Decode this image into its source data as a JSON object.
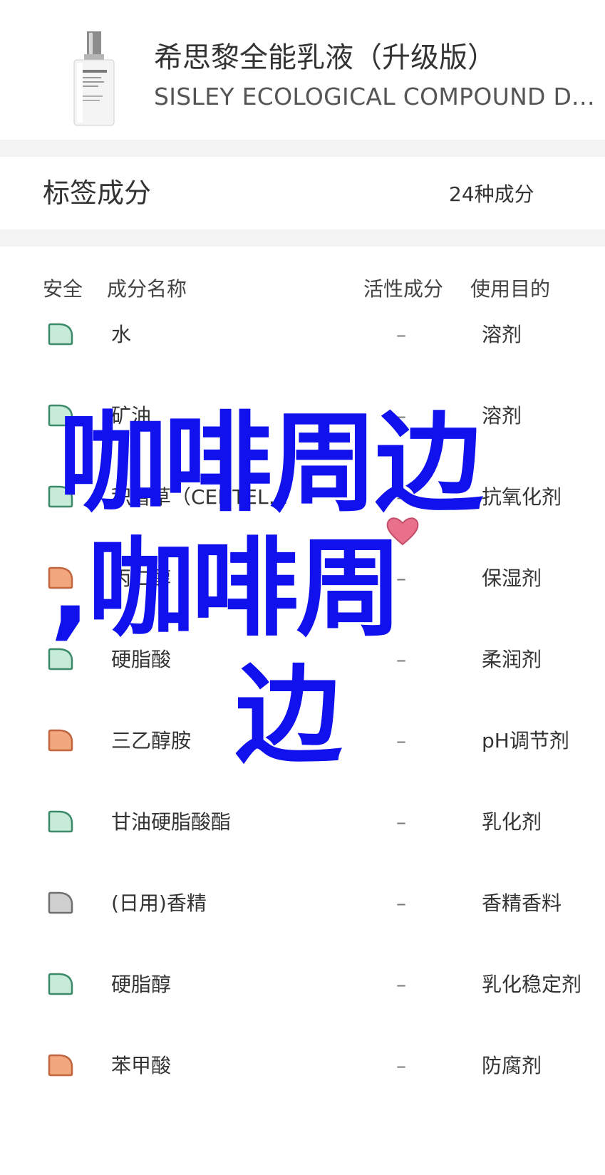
{
  "product": {
    "title": "希思黎全能乳液（升级版）",
    "subtitle": "SISLEY ECOLOGICAL COMPOUND DAY AND NIGHT"
  },
  "tags": {
    "label": "标签成分",
    "count": "24种成分"
  },
  "table": {
    "headers": {
      "safety": "安全",
      "name": "成分名称",
      "active": "活性成分",
      "purpose": "使用目的"
    },
    "rows": [
      {
        "safety": "green",
        "name": "水",
        "active": "–",
        "purpose": "溶剂"
      },
      {
        "safety": "green",
        "name": "矿油",
        "active": "–",
        "purpose": "溶剂"
      },
      {
        "safety": "green",
        "name": "积雪草（CENTELLA ASIATICA）",
        "active": "–",
        "purpose": "抗氧化剂"
      },
      {
        "safety": "orange",
        "name": "丙二醇",
        "active": "–",
        "purpose": "保湿剂"
      },
      {
        "safety": "green",
        "name": "硬脂酸",
        "active": "–",
        "purpose": "柔润剂"
      },
      {
        "safety": "orange",
        "name": "三乙醇胺",
        "active": "–",
        "purpose": "pH调节剂"
      },
      {
        "safety": "green",
        "name": "甘油硬脂酸酯",
        "active": "–",
        "purpose": "乳化剂"
      },
      {
        "safety": "gray",
        "name": "(日用)香精",
        "active": "–",
        "purpose": "香精香料"
      },
      {
        "safety": "green",
        "name": "硬脂醇",
        "active": "–",
        "purpose": "乳化稳定剂"
      },
      {
        "safety": "orange",
        "name": "苯甲酸",
        "active": "–",
        "purpose": "防腐剂"
      }
    ]
  },
  "overlay": {
    "line1": "咖啡周边",
    "line2": ",咖啡周",
    "line3": "边"
  },
  "colors": {
    "safe_green": "#c6ebd8",
    "safe_green_stroke": "#3c8a6a",
    "warn_orange": "#f2a77f",
    "warn_orange_stroke": "#c0653e",
    "unknown_gray": "#d0d0d0",
    "unknown_gray_stroke": "#6f6f6f",
    "overlay_blue": "#1111ee"
  }
}
